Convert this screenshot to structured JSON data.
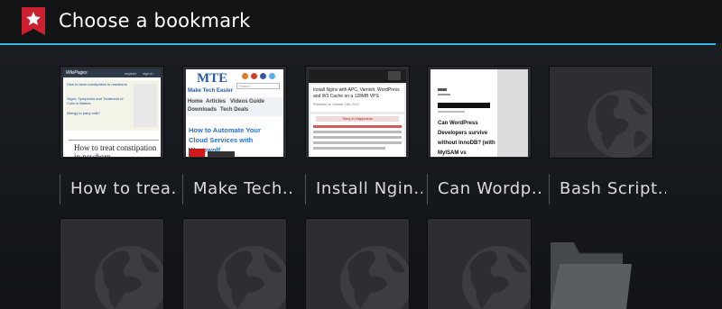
{
  "header": {
    "title": "Choose a bookmark",
    "accent_color": "#33b5e5",
    "icon_color": "#cc1f2f"
  },
  "bookmarks": [
    {
      "label": "How to trea..",
      "preview": {
        "site": "WikiPages",
        "nav": [
          "register",
          "sign in"
        ],
        "links": [
          "How to treat constipation in newborns",
          "Signs, Symptoms and Treatment of Colic in Babies",
          "Allergy to baby milk?"
        ],
        "heading": "How to treat constipation in newborn"
      }
    },
    {
      "label": "Make Tech..",
      "preview": {
        "logo": "MTE",
        "site": "Make Tech Easier",
        "search_placeholder": "Search",
        "nav": [
          "Home",
          "Articles",
          "Videos",
          "Guide",
          "Downloads",
          "Tech Deals"
        ],
        "headline": "How to Automate Your Cloud Services with Wappwolf"
      }
    },
    {
      "label": "Install Ngin..",
      "preview": {
        "headline": "Install Nginx with APC, Varnish, WordPress and W3 Cache on a 128MB VPS",
        "meta": "Published on October 19th, 2011",
        "banner": "Story in Happiness"
      }
    },
    {
      "label": "Can Wordp..",
      "preview": {
        "headline": "Can WordPress Developers survive without InnoDB? (with MyISAM vs"
      }
    },
    {
      "label": "Bash Script..",
      "preview": null
    }
  ],
  "second_row_count": 4
}
